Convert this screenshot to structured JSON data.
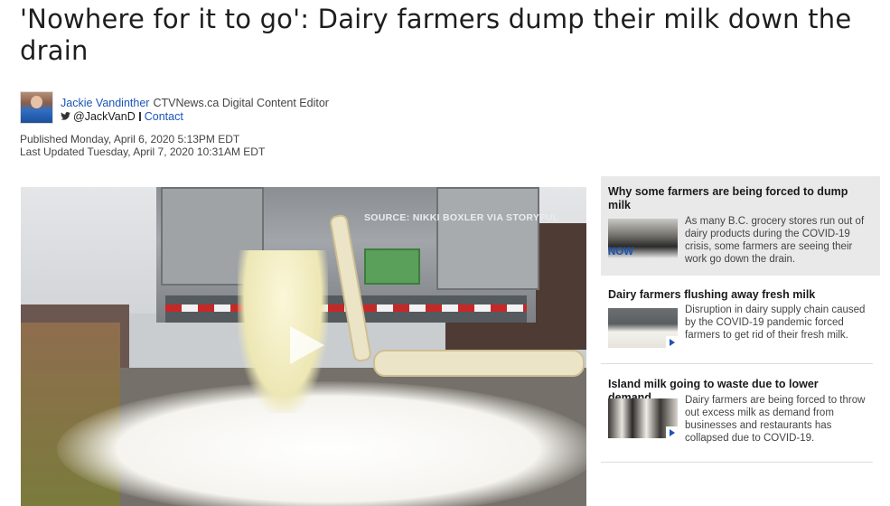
{
  "article": {
    "headline": "'Nowhere for it to go': Dairy farmers dump their milk down the drain",
    "author_name": "Jackie Vandinther",
    "author_role": "CTVNews.ca Digital Content Editor",
    "twitter_handle": "@JackVanD",
    "contact_label": "Contact",
    "published": "Published Monday, April 6, 2020 5:13PM EDT",
    "updated": "Last Updated Tuesday, April 7, 2020 10:31AM EDT"
  },
  "video": {
    "source_caption": "SOURCE: NIKKI BOXLER VIA STORYFUL"
  },
  "sidebar": {
    "stories": [
      {
        "title": "Why some farmers are being forced to dump milk",
        "summary": "As many B.C. grocery stores run out of dairy products during the COVID-19 crisis, some farmers are seeing their work go down the drain.",
        "badge": "NOW"
      },
      {
        "title": "Dairy farmers flushing away fresh milk",
        "summary": "Disruption in dairy supply chain caused by the COVID-19 pandemic forced farmers to get rid of their fresh milk."
      },
      {
        "title": "Island milk going to waste due to lower demand",
        "summary": "Dairy farmers are being forced to throw out excess milk as demand from businesses and restaurants has collapsed due to COVID-19."
      }
    ]
  },
  "colors": {
    "link": "#1a55b8",
    "featured_bg": "#e9e9e9",
    "text": "#1a1a1a"
  },
  "icons": [
    "twitter-icon",
    "play-icon"
  ]
}
